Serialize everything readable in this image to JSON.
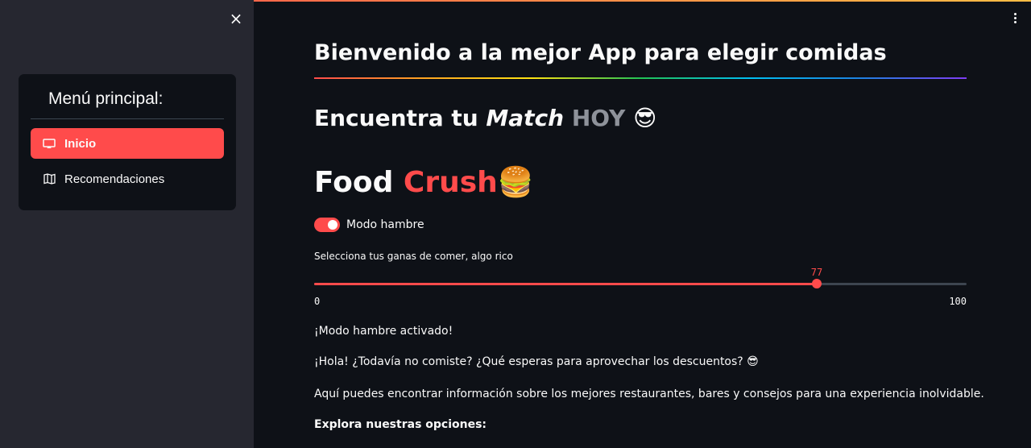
{
  "sidebar": {
    "close_glyph": "×",
    "menu_title": "Menú principal:",
    "items": [
      {
        "label": "Inicio",
        "icon": "cast-icon",
        "active": true
      },
      {
        "label": "Recomendaciones",
        "icon": "map-icon",
        "active": false
      }
    ]
  },
  "main": {
    "title": "Bienvenido a la mejor App para elegir comidas",
    "subtitle": {
      "part1": "Encuentra tu ",
      "em": "Match",
      "grey": " HOY",
      "emoji": " 😎"
    },
    "brand": {
      "part1": "Food ",
      "red": "Crush",
      "emoji": "🍔"
    },
    "toggle": {
      "label": "Modo hambre",
      "on": true
    },
    "slider": {
      "label": "Selecciona tus ganas de comer, algo rico",
      "value": 77,
      "min": 0,
      "max": 100
    },
    "paragraphs": [
      "¡Modo hambre activado!",
      "¡Hola! ¿Todavía no comiste? ¿Qué esperas para aprovechar los descuentos? 😎",
      "Aquí puedes encontrar información sobre los mejores restaurantes, bares y consejos para una experiencia inolvidable.",
      "Explora nuestras opciones:"
    ]
  },
  "colors": {
    "accent": "#ff4b4b",
    "background": "#0e1117",
    "sidebar": "#262730",
    "text": "#fafafa",
    "muted": "#8e929a"
  }
}
